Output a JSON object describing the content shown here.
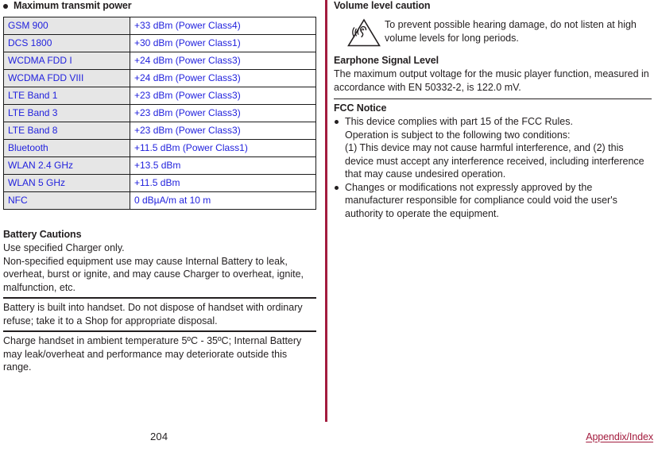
{
  "page": {
    "number": "204",
    "footer_link": "Appendix/Index"
  },
  "left_column": {
    "heading": "Maximum transmit power",
    "table": {
      "rows": [
        {
          "tech": "GSM 900",
          "value": "+33 dBm (Power Class4)"
        },
        {
          "tech": "DCS 1800",
          "value": "+30 dBm (Power Class1)"
        },
        {
          "tech": "WCDMA FDD I",
          "value": "+24 dBm (Power Class3)"
        },
        {
          "tech": "WCDMA FDD VIII",
          "value": "+24 dBm (Power Class3)"
        },
        {
          "tech": "LTE Band 1",
          "value": "+23 dBm (Power Class3)"
        },
        {
          "tech": "LTE Band 3",
          "value": "+23 dBm (Power Class3)"
        },
        {
          "tech": "LTE Band 8",
          "value": "+23 dBm (Power Class3)"
        },
        {
          "tech": "Bluetooth",
          "value": "+11.5 dBm (Power Class1)"
        },
        {
          "tech": "WLAN 2.4 GHz",
          "value": "+13.5 dBm"
        },
        {
          "tech": "WLAN 5 GHz",
          "value": "+11.5 dBm"
        },
        {
          "tech": "NFC",
          "value": "0 dBµA/m at 10 m"
        }
      ]
    },
    "battery_cautions": {
      "heading": "Battery Cautions",
      "block1_line1": "Use specified Charger only.",
      "block1_line2": "Non-specified equipment use may cause Internal Battery to leak, overheat, burst or ignite, and may cause Charger to overheat, ignite, malfunction, etc.",
      "block2": "Battery is built into handset. Do not dispose of handset with ordinary refuse; take it to a Shop for appropriate disposal.",
      "block3": "Charge handset in ambient temperature 5ºC - 35ºC; Internal Battery may leak/overheat and performance may deteriorate outside this range."
    }
  },
  "right_column": {
    "volume_caution": {
      "heading": "Volume level caution",
      "warning_text": "To prevent possible hearing damage, do not listen at high volume levels for long periods.",
      "earphone_heading": "Earphone Signal Level",
      "earphone_text": "The maximum output voltage for the music player function, measured in accordance with EN 50332-2, is 122.0 mV."
    },
    "fcc_notice": {
      "heading": "FCC Notice",
      "bullets": [
        {
          "lines": [
            "This device complies with part 15 of the FCC Rules.",
            "Operation is subject to the following two conditions:",
            "(1) This device may not cause harmful interference, and (2) this device must accept any interference received, including interference that may cause undesired operation."
          ]
        },
        {
          "lines": [
            "Changes or modifications not expressly approved by the manufacturer responsible for compliance could void the user's authority to operate the equipment."
          ]
        }
      ]
    }
  },
  "colors": {
    "accent_crimson": "#a31c3e",
    "table_text_blue": "#2222dd",
    "table_label_bg": "#e6e6e6",
    "body_text": "#231f20"
  }
}
